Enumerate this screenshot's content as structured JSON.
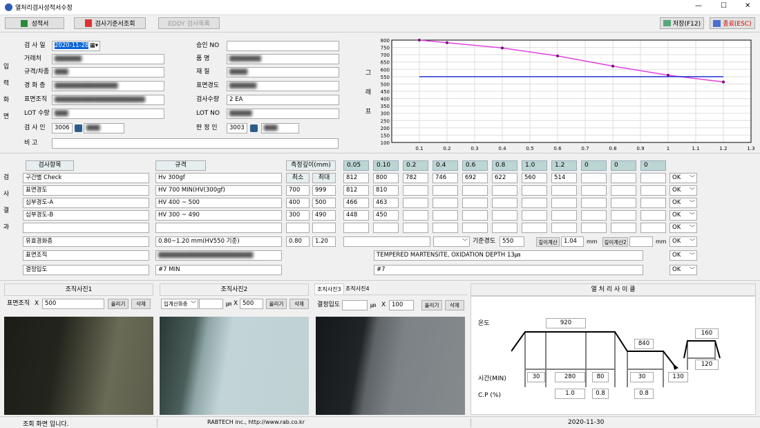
{
  "window": {
    "title": "열처리검사성적서수정",
    "min": "—",
    "max": "☐",
    "close": "✕"
  },
  "toolbar": {
    "report": "성적서",
    "standard": "검사기준서조회",
    "eddy": "EDDY 검사목록",
    "save": "저장(F12)",
    "exit": "종료(ESC)"
  },
  "side": {
    "input": [
      "입",
      "력",
      "화",
      "면"
    ],
    "result": [
      "검",
      "사",
      "결",
      "과"
    ]
  },
  "form": {
    "date_label": "검 사 일",
    "date_value": "2020-11-28",
    "customer_label": "거래처",
    "spec_label": "규격/차종",
    "order_label": "경 화 층",
    "surface_label": "표면조직",
    "lot_label": "LOT 수량",
    "inspector_label": "검 사 인",
    "inspector_code": "3006",
    "note_label": "비 고",
    "approve_label": "승인 NO",
    "item_label": "품 명",
    "material_label": "재 질",
    "hardness_label": "표면경도",
    "qty_label": "검사수량",
    "qty_value": "2 EA",
    "lotno_label": "LOT NO",
    "judge_label": "판 정 인",
    "judge_code": "3003"
  },
  "chart_data": {
    "type": "line",
    "x": [
      0.1,
      0.2,
      0.4,
      0.6,
      0.8,
      1.0,
      1.2
    ],
    "series": [
      {
        "values": [
          800,
          782,
          746,
          692,
          622,
          560,
          514
        ],
        "color": "#e040e0"
      },
      {
        "values": [
          550,
          550,
          550,
          550,
          550,
          550,
          550
        ],
        "color": "#2030d0"
      }
    ],
    "xlim": [
      0,
      1.3
    ],
    "ylim": [
      100,
      800
    ],
    "xticks": [
      "0.1",
      "0.2",
      "0.3",
      "0.4",
      "0.5",
      "0.6",
      "0.7",
      "0.8",
      "0.9",
      "1",
      "1.1",
      "1.2",
      "1.3"
    ],
    "yticks": [
      "800",
      "750",
      "700",
      "650",
      "600",
      "550",
      "500",
      "450",
      "400",
      "350",
      "300",
      "250",
      "200",
      "150",
      "100"
    ],
    "ylabel": [
      "그",
      "래",
      "프"
    ],
    "grid": true
  },
  "table": {
    "col_item": "검사항목",
    "col_spec": "규격",
    "col_depth": "측정깊이(mm)",
    "min": "최소",
    "max": "최대",
    "depths": [
      "0.05",
      "0.10",
      "0.2",
      "0.4",
      "0.6",
      "0.8",
      "1.0",
      "1.2",
      "0",
      "0",
      "0"
    ],
    "rows": [
      {
        "item": "구간별 Check",
        "spec": "Hv 300gf",
        "min": "",
        "max": "",
        "vals": [
          "812",
          "800",
          "782",
          "746",
          "692",
          "622",
          "560",
          "514",
          "",
          "",
          ""
        ],
        "ok": "OK"
      },
      {
        "item": "표면경도",
        "spec": "HV 700 MIN(HV(300gf)",
        "min": "700",
        "max": "999",
        "vals": [
          "812",
          "810",
          "",
          "",
          "",
          "",
          "",
          "",
          "",
          "",
          ""
        ],
        "ok": "OK"
      },
      {
        "item": "심부경도-A",
        "spec": "HV 400 ~ 500",
        "min": "400",
        "max": "500",
        "vals": [
          "466",
          "463",
          "",
          "",
          "",
          "",
          "",
          "",
          "",
          "",
          ""
        ],
        "ok": "OK"
      },
      {
        "item": "심부경도-B",
        "spec": "HV 300 ~ 490",
        "min": "300",
        "max": "490",
        "vals": [
          "448",
          "450",
          "",
          "",
          "",
          "",
          "",
          "",
          "",
          "",
          ""
        ],
        "ok": "OK"
      },
      {
        "item": "",
        "spec": "",
        "min": "",
        "max": "",
        "vals": [
          "",
          "",
          "",
          "",
          "",
          "",
          "",
          "",
          "",
          "",
          ""
        ],
        "ok": "OK"
      }
    ],
    "eff_item": "유효경화층",
    "eff_spec": "0.80~1.20 mm(HV550 기준)",
    "eff_min": "0.80",
    "eff_max": "1.20",
    "eff_std_label": "기준경도",
    "eff_std": "550",
    "calc1": "깊이계산",
    "calc1_val": "1.04",
    "mm": "mm",
    "calc2": "깊이계산2",
    "eff_ok": "OK",
    "surf_item": "표면조직",
    "surf_result": "TEMPERED MARTENSITE, OXIDATION DEPTH 13㎛",
    "surf_ok": "OK",
    "grain_item": "결정입도",
    "grain_spec": "#7 MIN",
    "grain_result": "#7",
    "grain_ok": "OK"
  },
  "photos": {
    "p1_title": "조직사진1",
    "p1_label": "표면조직",
    "p1_x": "X",
    "p1_mag": "500",
    "upload": "올리기",
    "delete": "삭제",
    "p2_title": "조직사진2",
    "p2_select": "입계산화층",
    "p2_unit": "㎛",
    "p2_x": "X",
    "p2_mag": "500",
    "tab3": "조직사진3",
    "tab4": "조직사진4",
    "p3_label": "결정입도",
    "p3_unit": "㎛",
    "p3_x": "X",
    "p3_mag": "100"
  },
  "cycle": {
    "title": "열 처 리 사 이 클",
    "temp_label": "온도",
    "time_label": "시간(MIN)",
    "cp_label": "C.P (%)",
    "t1": "920",
    "t2": "840",
    "t3": "160",
    "tm1": "30",
    "tm2": "280",
    "tm3": "80",
    "tm4": "30",
    "tm5": "130",
    "tm6": "120",
    "cp1": "1.0",
    "cp2": "0.8",
    "cp3": "0.8"
  },
  "status": {
    "left": "조회 화면 입니다.",
    "mid": "RABTECH inc., http://www.rab.co.kr",
    "right": "2020-11-30"
  }
}
